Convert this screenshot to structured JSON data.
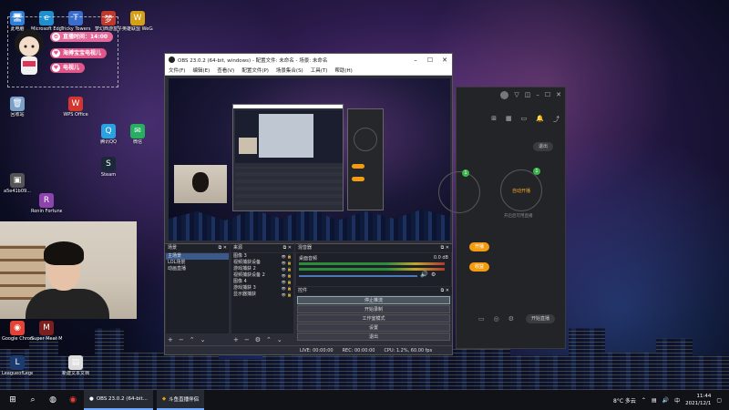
{
  "desktop": {
    "icons": [
      {
        "label": "此电脑",
        "glyph": "🖥",
        "color": "#2f7fd8"
      },
      {
        "label": "Microsoft Edge",
        "glyph": "e",
        "color": "#1f8fd0"
      },
      {
        "label": "Tricky Towers",
        "glyph": "T",
        "color": "#3a6ecc"
      },
      {
        "label": "梦幻西游盒子",
        "glyph": "梦",
        "color": "#c0392b"
      },
      {
        "label": "英雄联盟 WeGame",
        "glyph": "W",
        "color": "#d4a017"
      },
      {
        "label": "回收站",
        "glyph": "🗑",
        "color": "#7aa0c8"
      },
      {
        "label": "WPS Office",
        "glyph": "W",
        "color": "#d2362f"
      },
      {
        "label": "腾讯QQ",
        "glyph": "Q",
        "color": "#2aa1e0"
      },
      {
        "label": "微信",
        "glyph": "✉",
        "color": "#27ae60"
      },
      {
        "label": "Steam",
        "glyph": "S",
        "color": "#1b2838"
      },
      {
        "label": "a5e41b09...",
        "glyph": "▣",
        "color": "#555"
      },
      {
        "label": "Ronin Fortune",
        "glyph": "R",
        "color": "#8e44ad"
      },
      {
        "label": "Google Chrome",
        "glyph": "◉",
        "color": "#e34234"
      },
      {
        "label": "Super Meat Man",
        "glyph": "M",
        "color": "#7b1f1f"
      },
      {
        "label": "LeagueofLegends",
        "glyph": "L",
        "color": "#1c3b6e"
      },
      {
        "label": "新建文本文档",
        "glyph": "▤",
        "color": "#dddddd"
      }
    ]
  },
  "avatar_widget": {
    "time_label": "直播时间：14:00",
    "line1": "海搏宝宝电视儿",
    "line2": "电视儿"
  },
  "obs": {
    "title": "OBS 23.0.2 (64-bit, windows) - 配置文件: 未命名 - 场景: 未命名",
    "menu": [
      "文件(F)",
      "编辑(E)",
      "查看(V)",
      "配置文件(P)",
      "场景集合(S)",
      "工具(T)",
      "帮助(H)"
    ],
    "docks": {
      "scenes": {
        "title": "场景",
        "items": [
          "主场景",
          "LOL场景",
          "动画直播"
        ]
      },
      "sources": {
        "title": "来源",
        "items": [
          "图像 3",
          "视频捕获设备",
          "游戏捕获 2",
          "视频捕获设备 2",
          "图像 4",
          "游戏捕获 3",
          "显示器捕获"
        ]
      },
      "mixer": {
        "title": "混音器",
        "channel": "桌面音频",
        "level": "0.0 dB"
      },
      "controls": {
        "title": "控件",
        "buttons": [
          "停止推流",
          "开始录制",
          "工作室模式",
          "设置",
          "退出"
        ]
      }
    },
    "status": {
      "live": "LIVE: 00:00:00",
      "rec": "REC: 00:00:00",
      "cpu": "CPU: 1.2%, 60.00 fps"
    }
  },
  "assistant": {
    "logout": "退出",
    "auto_label": "自动开播",
    "desc": "开启后可用直播",
    "rows": [
      "开播",
      "收益"
    ],
    "bottom_btn": "开始直播"
  },
  "taskbar": {
    "tasks": [
      {
        "label": "OBS 23.0.2 (64-bit..."
      },
      {
        "label": "斗鱼直播伴侣"
      }
    ],
    "weather": "8°C 多云",
    "time": "11:44",
    "date": "2021/12/1",
    "lang": "中"
  }
}
